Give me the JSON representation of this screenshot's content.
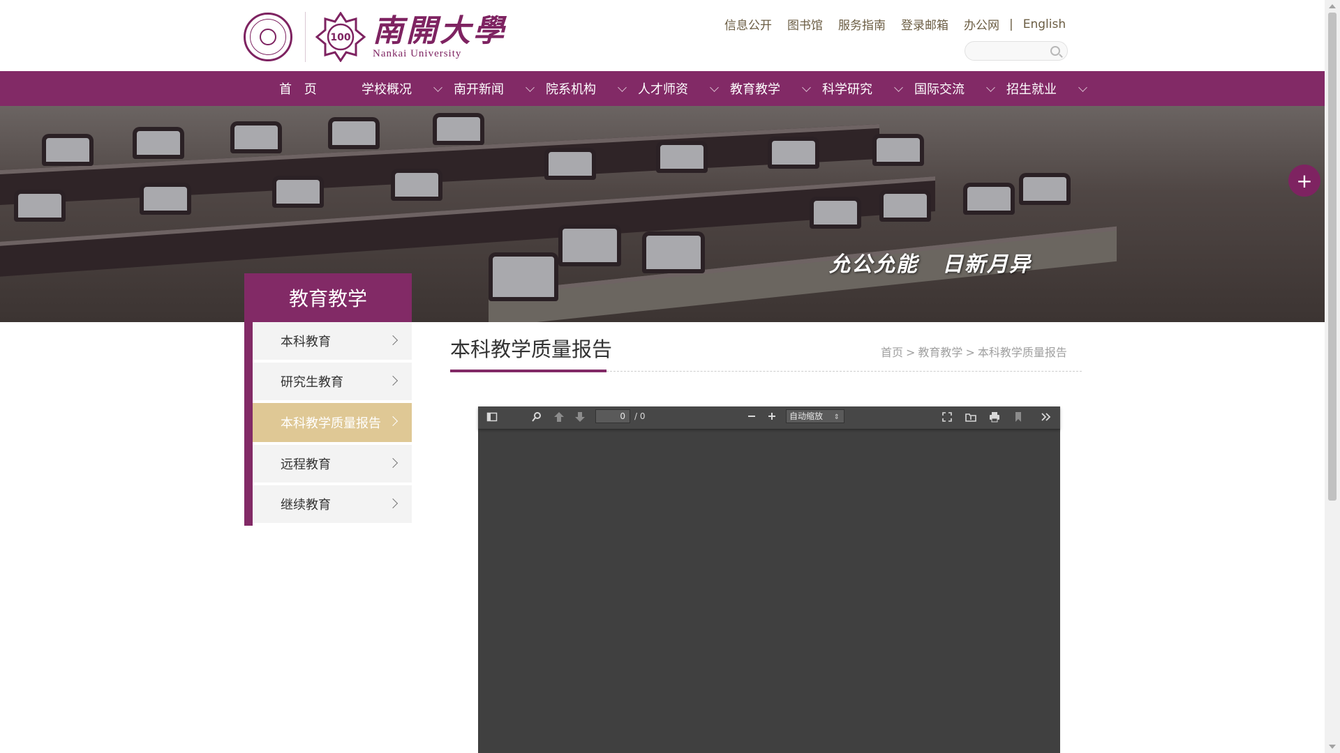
{
  "header": {
    "logo_cn": "南開大學",
    "logo_en": "Nankai University",
    "badge_text": "100",
    "top_links": [
      "信息公开",
      "图书馆",
      "服务指南",
      "登录邮箱",
      "办公网"
    ],
    "separator": "|",
    "english_link": "English",
    "search_placeholder": ""
  },
  "nav": {
    "items": [
      "首 页",
      "学校概况",
      "南开新闻",
      "院系机构",
      "人才师资",
      "教育教学",
      "科学研究",
      "国际交流",
      "招生就业"
    ]
  },
  "banner": {
    "slogan_1": "允公允能",
    "slogan_2": "日新月异",
    "plus": "+"
  },
  "sidebar": {
    "title": "教育教学",
    "items": [
      {
        "label": "本科教育"
      },
      {
        "label": "研究生教育"
      },
      {
        "label": "本科教学质量报告"
      },
      {
        "label": "远程教育"
      },
      {
        "label": "继续教育"
      }
    ],
    "active_index": 2
  },
  "content": {
    "title": "本科教学质量报告",
    "breadcrumb": [
      "首页",
      "教育教学",
      "本科教学质量报告"
    ],
    "breadcrumb_sep": ">"
  },
  "viewer": {
    "page_value": "0",
    "page_count": "/ 0",
    "zoom_label": "自动缩放",
    "icons": [
      "sidebar-toggle-icon",
      "search-icon",
      "previous-page-icon",
      "next-page-icon",
      "zoom-out-icon",
      "zoom-in-icon",
      "presentation-mode-icon",
      "open-file-icon",
      "print-icon",
      "bookmark-icon",
      "tools-icon"
    ]
  },
  "colors": {
    "brand": "#822a66",
    "active_item": "#dfc895",
    "viewer_bg": "#404040"
  }
}
